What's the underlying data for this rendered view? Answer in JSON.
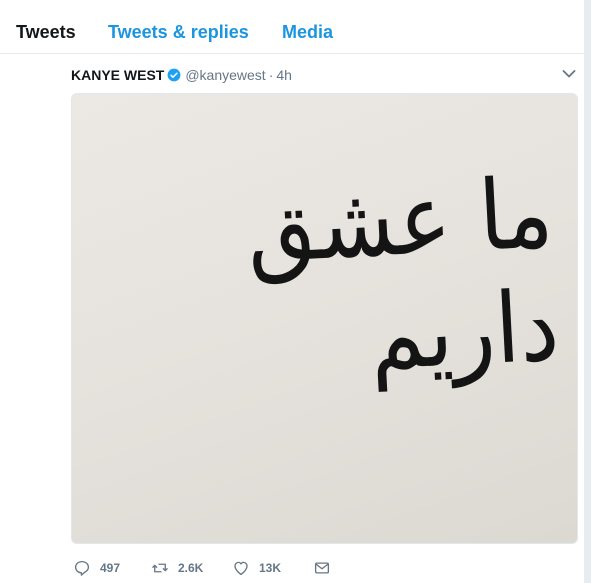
{
  "tabs": [
    {
      "label": "Tweets",
      "active": true
    },
    {
      "label": "Tweets & replies",
      "active": false
    },
    {
      "label": "Media",
      "active": false
    }
  ],
  "tweet": {
    "display_name": "KANYE WEST",
    "handle": "@kanyewest",
    "separator": "·",
    "time": "4h",
    "verified": true,
    "image_text": "ما عشق داریم",
    "stats": {
      "replies": "497",
      "retweets": "2.6K",
      "likes": "13K"
    }
  },
  "icons": {
    "verified": "verified-badge-icon",
    "caret": "chevron-down-icon",
    "reply": "reply-icon",
    "retweet": "retweet-icon",
    "like": "heart-icon",
    "message": "envelope-icon"
  },
  "colors": {
    "accent": "#1b95e0",
    "text": "#14171a",
    "muted": "#657786",
    "verified": "#1da1f2"
  }
}
